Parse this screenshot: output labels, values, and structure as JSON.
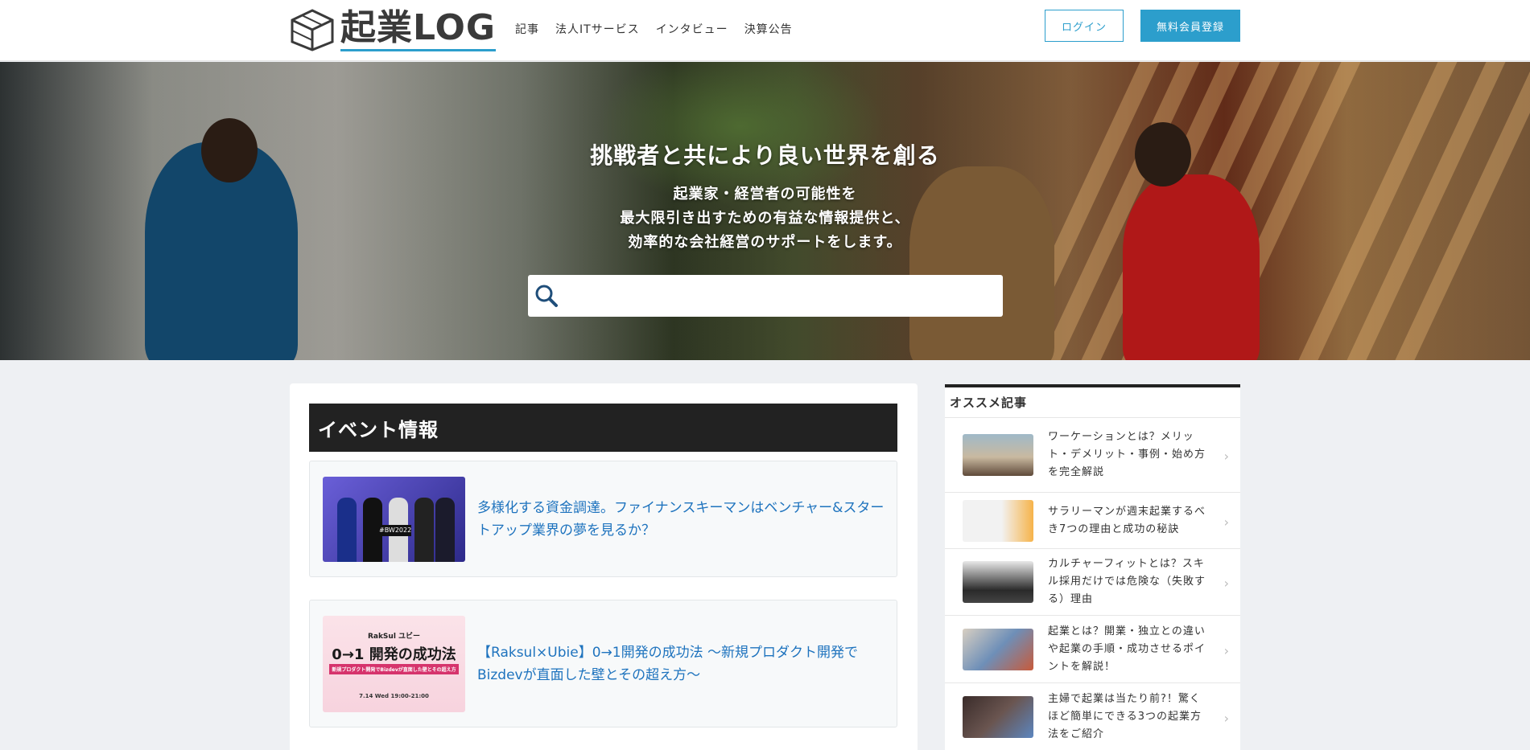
{
  "header": {
    "logo_text": "起業LOG",
    "nav": [
      "記事",
      "法人ITサービス",
      "インタビュー",
      "決算公告"
    ],
    "login_label": "ログイン",
    "register_label": "無料会員登録"
  },
  "hero": {
    "title": "挑戦者と共により良い世界を創る",
    "subtitle_lines": [
      "起業家・経営者の可能性を",
      "最大限引き出すための有益な情報提供と、",
      "効率的な会社経営のサポートをします。"
    ],
    "search_placeholder": ""
  },
  "main": {
    "section_title": "イベント情報",
    "events": [
      {
        "title": "多様化する資金調達。ファイナンスキーマンはベンチャー&スタートアップ業界の夢を見るか？",
        "thumb_text": "#BW2022"
      },
      {
        "title": "【Raksul×Ubie】0→1開発の成功法 〜新規プロダクト開発でBizdevが直面した壁とその超え方〜",
        "thumb_brand": "RakSul ユビー",
        "thumb_heading": "0→1 開発の成功法",
        "thumb_sub": "新規プロダクト開発でBizdevが直面した壁とその超え方",
        "thumb_date": "7.14 Wed 19:00-21:00"
      }
    ]
  },
  "sidebar": {
    "title": "オススメ記事",
    "items": [
      "ワーケーションとは？メリット・デメリット・事例・始め方を完全解説",
      "サラリーマンが週末起業するべき7つの理由と成功の秘訣",
      "カルチャーフィットとは？スキル採用だけでは危険な（失敗する）理由",
      "起業とは？開業・独立との違いや起業の手順・成功させるポイントを解説！",
      "主婦で起業は当たり前?！驚くほど簡単にできる3つの起業方法をご紹介"
    ]
  },
  "colors": {
    "accent": "#2c9ecc",
    "link": "#1e73be",
    "section_bg": "#222222"
  }
}
